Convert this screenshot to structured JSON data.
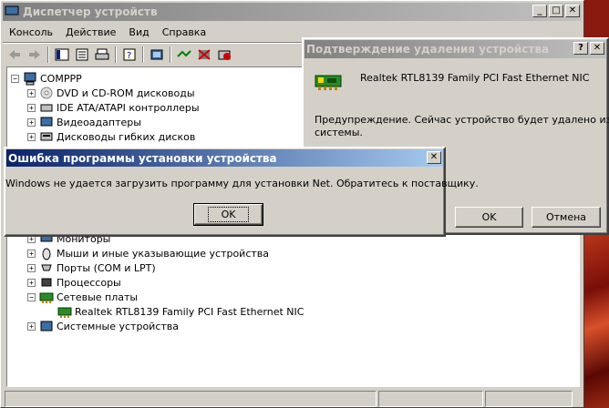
{
  "main_window": {
    "title": "Диспетчер устройств",
    "controls": {
      "minimize": "_",
      "maximize": "□",
      "close": "✕"
    },
    "menu": [
      "Консоль",
      "Действие",
      "Вид",
      "Справка"
    ],
    "toolbar_icons": [
      "back-icon",
      "forward-icon",
      "tree-icon",
      "properties-sheet-icon",
      "print-icon",
      "help-icon",
      "refresh-icon",
      "scan-hardware-icon",
      "disable-icon",
      "uninstall-icon"
    ],
    "tree": {
      "root": "COMPPP",
      "items": [
        {
          "label": "DVD и CD-ROM дисководы",
          "expander": "+",
          "icon": "cdrom-icon"
        },
        {
          "label": "IDE ATA/ATAPI контроллеры",
          "expander": "+",
          "icon": "ide-icon"
        },
        {
          "label": "Видеоадаптеры",
          "expander": "+",
          "icon": "display-adapter-icon"
        },
        {
          "label": "Дисководы гибких дисков",
          "expander": "+",
          "icon": "floppy-icon"
        },
        {
          "label": "Мониторы",
          "expander": "+",
          "icon": "monitor-icon"
        },
        {
          "label": "Мыши и иные указывающие устройства",
          "expander": "+",
          "icon": "mouse-icon"
        },
        {
          "label": "Порты (COM и LPT)",
          "expander": "+",
          "icon": "port-icon"
        },
        {
          "label": "Процессоры",
          "expander": "+",
          "icon": "cpu-icon"
        },
        {
          "label": "Сетевые платы",
          "expander": "−",
          "icon": "network-card-icon"
        },
        {
          "label": "Realtek RTL8139 Family PCI Fast Ethernet NIC",
          "expander": "",
          "icon": "network-card-icon"
        },
        {
          "label": "Системные устройства",
          "expander": "+",
          "icon": "system-devices-icon"
        }
      ]
    }
  },
  "confirm_dialog": {
    "title": "Подтверждение удаления устройства",
    "controls": {
      "help": "?",
      "close": "✕"
    },
    "device_name": "Realtek RTL8139 Family PCI Fast Ethernet NIC",
    "warning_line1": "Предупреждение. Сейчас устройство будет удалено из",
    "warning_line2": "системы.",
    "ok_label": "OK",
    "cancel_label": "Отмена"
  },
  "error_dialog": {
    "title": "Ошибка программы установки устройства",
    "controls": {
      "close": "✕"
    },
    "message": "Windows не удается загрузить программу для установки Net. Обратитесь к поставщику.",
    "ok_label": "OK"
  },
  "colors": {
    "active_title": "#0a246a",
    "inactive_title": "#808080",
    "face": "#d4d0c8",
    "desktop": "#8a1a10"
  }
}
